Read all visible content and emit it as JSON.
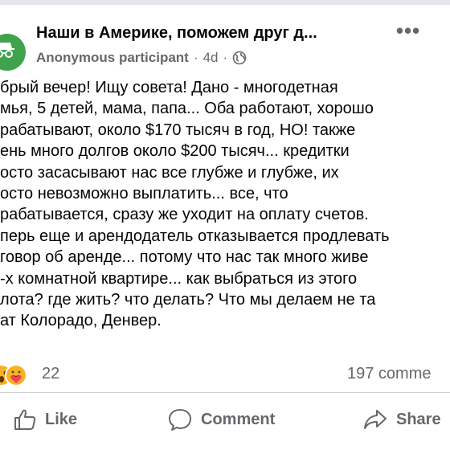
{
  "post": {
    "group_name": "Наши в Америке, поможем друг д...",
    "author": "Anonymous participant",
    "separator": "·",
    "time": "4d",
    "body_lines": [
      "брый вечер! Ищу совета! Дано - многодетная",
      "мья, 5 детей, мама, папа... Оба работают, хорошо",
      "рабатывают, около $170 тысяч в год, НО! также",
      "ень много долгов около $200 тысяч... кредитки",
      "осто засасывают нас все глубже и глубже, их",
      "осто невозможно выплатить... все, что",
      "рабатывается, сразу же уходит на оплату счетов.",
      "перь еще и арендодатель отказывается продлевать",
      "говор об аренде... потому что нас так много живе",
      "-х комнатной квартире... как выбраться из этого",
      "лота? где жить? что делать? Что мы делаем не та",
      "ат Колорадо, Денвер."
    ],
    "reaction_count": "22",
    "comment_count": "197 comme"
  },
  "actions": {
    "like": "Like",
    "comment": "Comment",
    "share": "Share"
  },
  "icons": {
    "avatar": "anonymous-avatar-icon",
    "more": "more-icon",
    "globe": "globe-icon",
    "reactions": [
      "wow-icon",
      "care-icon"
    ],
    "like": "thumbs-up-icon",
    "comment": "comment-bubble-icon",
    "share": "share-arrow-icon"
  },
  "colors": {
    "avatar_bg": "#3fa34d",
    "secondary_text": "#65676b",
    "reaction_yellow": "#f7b125"
  }
}
